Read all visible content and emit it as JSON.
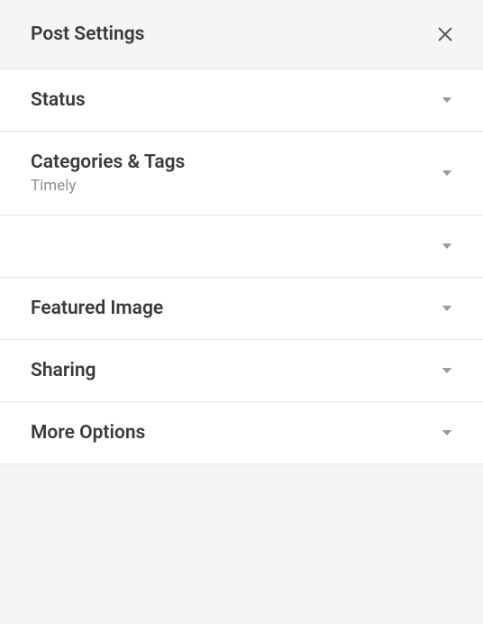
{
  "header": {
    "title": "Post Settings"
  },
  "sections": {
    "status": {
      "title": "Status"
    },
    "categories": {
      "title": "Categories & Tags",
      "subtitle": "Timely"
    },
    "empty": {
      "title": ""
    },
    "featured": {
      "title": "Featured Image"
    },
    "sharing": {
      "title": "Sharing"
    },
    "more": {
      "title": "More Options"
    }
  }
}
